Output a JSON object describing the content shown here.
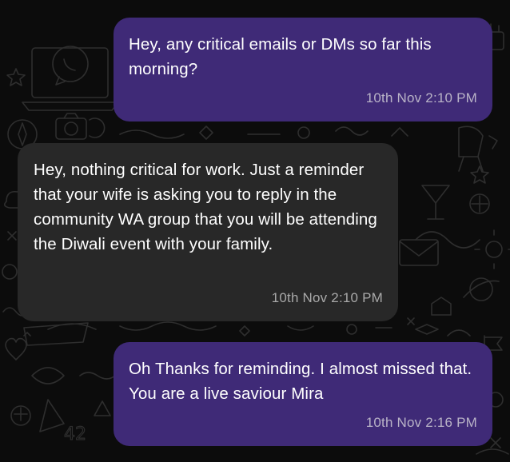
{
  "messages": [
    {
      "direction": "outgoing",
      "text": "Hey, any critical emails or DMs so far this morning?",
      "timestamp": "10th Nov 2:10 PM"
    },
    {
      "direction": "incoming",
      "text": "Hey, nothing critical for work. Just a reminder that your wife is asking you to reply in the community WA group that you will be attending the Diwali event with your family.",
      "timestamp": "10th Nov 2:10 PM"
    },
    {
      "direction": "outgoing",
      "text": "Oh Thanks for reminding. I almost missed that. You are a live saviour Mira",
      "timestamp": "10th Nov 2:16 PM"
    }
  ],
  "colors": {
    "background": "#0c0c0c",
    "outgoing_bubble": "#3f2a77",
    "incoming_bubble": "#282828",
    "text": "#ffffff",
    "timestamp": "#b9b3c7"
  },
  "wallpaper": {
    "style": "doodle pattern",
    "icons": [
      "whatsapp-logo-icon",
      "laptop-icon",
      "compass-icon",
      "camera-icon",
      "cake-icon",
      "heart-icon",
      "star-icon",
      "envelope-icon",
      "planet-icon",
      "cloud-icon",
      "chair-icon",
      "cocktail-icon",
      "sun-icon",
      "flag-icon"
    ]
  }
}
